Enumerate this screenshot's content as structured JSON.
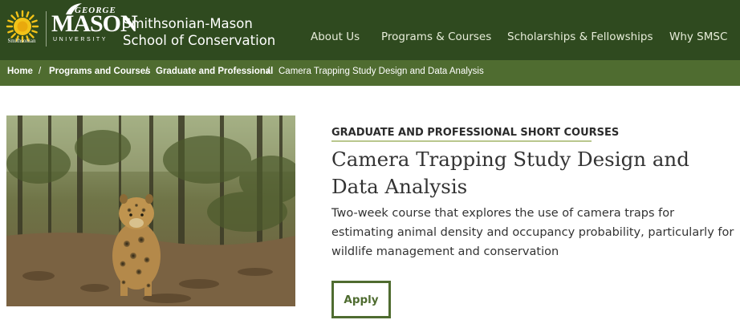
{
  "header": {
    "smithsonian_logo_text": "Smithsonian",
    "gmu_logo": {
      "george": "GEORGE",
      "mason": "MASON",
      "university": "UNIVERSITY"
    },
    "site_name_line1": "Smithsonian-Mason",
    "site_name_line2": "School of Conservation",
    "nav": [
      {
        "label": "About Us"
      },
      {
        "label": "Programs & Courses"
      },
      {
        "label": "Scholarships & Fellowships"
      },
      {
        "label": "Why SMSC"
      }
    ]
  },
  "breadcrumb": {
    "items": [
      {
        "label": "Home"
      },
      {
        "label": "Programs and Courses"
      },
      {
        "label": "Graduate and Professional"
      },
      {
        "label": "Camera Trapping Study Design and Data Analysis"
      }
    ],
    "separator": "/"
  },
  "course": {
    "eyebrow": "GRADUATE AND PROFESSIONAL SHORT COURSES",
    "title": "Camera Trapping Study Design and Data Analysis",
    "description": "Two-week course that explores the use of camera traps for estimating animal density and occupancy probability, particularly for wildlife management and conservation",
    "apply_label": "Apply"
  },
  "image": {
    "subject": "jaguar-in-forest-camera-trap-photo"
  },
  "colors": {
    "header_bg": "#2f4a1f",
    "breadcrumb_bg": "#4f6c30",
    "accent": "#4f6c30",
    "eyebrow_underline": "#b9c78d",
    "sun_yellow": "#f2c318"
  }
}
